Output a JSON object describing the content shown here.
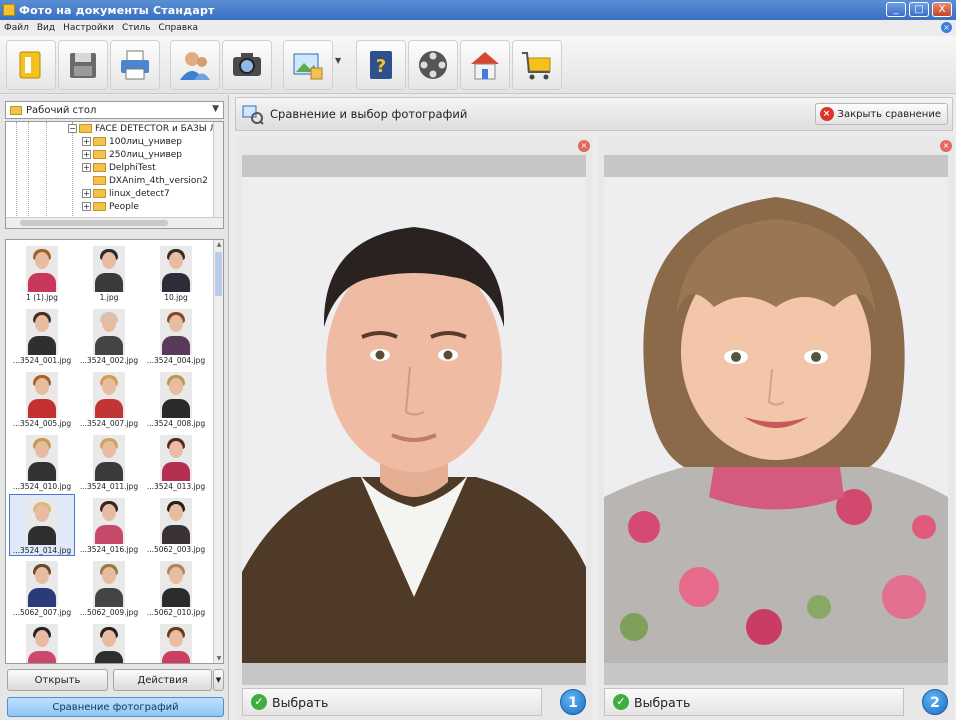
{
  "window": {
    "title": "Фото на документы Стандарт",
    "buttons": [
      "_",
      "□",
      "X"
    ]
  },
  "menu": [
    "Файл",
    "Вид",
    "Настройки",
    "Стиль",
    "Справка"
  ],
  "toolbar": {
    "icons": [
      "home-icon",
      "save-icon",
      "print-icon",
      "user-icon",
      "camera-icon",
      "image-edit-icon",
      "help-book-icon",
      "film-reel-icon",
      "house-icon",
      "shopping-cart-icon"
    ]
  },
  "left": {
    "folder_select": "Рабочий стол",
    "tree": [
      {
        "label": "FACE DETECTOR и БАЗЫ Л",
        "expand": "−"
      },
      {
        "label": "100лиц_универ",
        "expand": "+"
      },
      {
        "label": "250лиц_универ",
        "expand": "+"
      },
      {
        "label": "DelphiTest",
        "expand": "+"
      },
      {
        "label": "DXAnim_4th_version2",
        "expand": ""
      },
      {
        "label": "linux_detect7",
        "expand": "+"
      },
      {
        "label": "People",
        "expand": "+"
      }
    ],
    "thumbnails": [
      {
        "caption": "1 (1).jpg",
        "hair": "#a0602a",
        "body": "#c9375a"
      },
      {
        "caption": "1.jpg",
        "hair": "#2a2a2a",
        "body": "#3a3a3a"
      },
      {
        "caption": "10.jpg",
        "hair": "#3a2a20",
        "body": "#2d2d3a"
      },
      {
        "caption": "...3524_001.jpg",
        "hair": "#4a2f20",
        "body": "#2f2f2f"
      },
      {
        "caption": "...3524_002.jpg",
        "hair": "#cfc6b8",
        "body": "#444"
      },
      {
        "caption": "...3524_004.jpg",
        "hair": "#8a4a2a",
        "body": "#5a3a5a"
      },
      {
        "caption": "...3524_005.jpg",
        "hair": "#a5642a",
        "body": "#c43030"
      },
      {
        "caption": "...3524_007.jpg",
        "hair": "#d0a050",
        "body": "#c23535"
      },
      {
        "caption": "...3524_008.jpg",
        "hair": "#b89a55",
        "body": "#2a2a2a"
      },
      {
        "caption": "...3524_010.jpg",
        "hair": "#c69a50",
        "body": "#333"
      },
      {
        "caption": "...3524_011.jpg",
        "hair": "#c9a563",
        "body": "#3a3a3a"
      },
      {
        "caption": "...3524_013.jpg",
        "hair": "#5a2a20",
        "body": "#b43050"
      },
      {
        "caption": "...3524_014.jpg",
        "hair": "#d8bb7a",
        "body": "#2e2e2e",
        "selected": true
      },
      {
        "caption": "...3524_016.jpg",
        "hair": "#3a2520",
        "body": "#c8486a"
      },
      {
        "caption": "...5062_003.jpg",
        "hair": "#2a1d18",
        "body": "#3a3036"
      },
      {
        "caption": "...5062_007.jpg",
        "hair": "#6a4a2a",
        "body": "#2a3a7a"
      },
      {
        "caption": "...5062_009.jpg",
        "hair": "#9a7a45",
        "body": "#444"
      },
      {
        "caption": "...5062_010.jpg",
        "hair": "#a88a55",
        "body": "#2c2c2c"
      },
      {
        "caption": "",
        "hair": "#2a2020",
        "body": "#c94a6a"
      },
      {
        "caption": "",
        "hair": "#2a2020",
        "body": "#2e2e2e"
      },
      {
        "caption": "",
        "hair": "#6a3a25",
        "body": "#c94060"
      }
    ],
    "open_button": "Открыть",
    "actions_button": "Действия",
    "compare_button": "Сравнение фотографий"
  },
  "right": {
    "header_title": "Сравнение и выбор фотографий",
    "close_compare": "Закрыть сравнение",
    "panels": [
      {
        "select_label": "Выбрать",
        "number": "1"
      },
      {
        "select_label": "Выбрать",
        "number": "2"
      }
    ]
  },
  "colors": {
    "accent": "#3d7de0",
    "select_green": "#3fae3f",
    "close_red": "#d9362a"
  }
}
